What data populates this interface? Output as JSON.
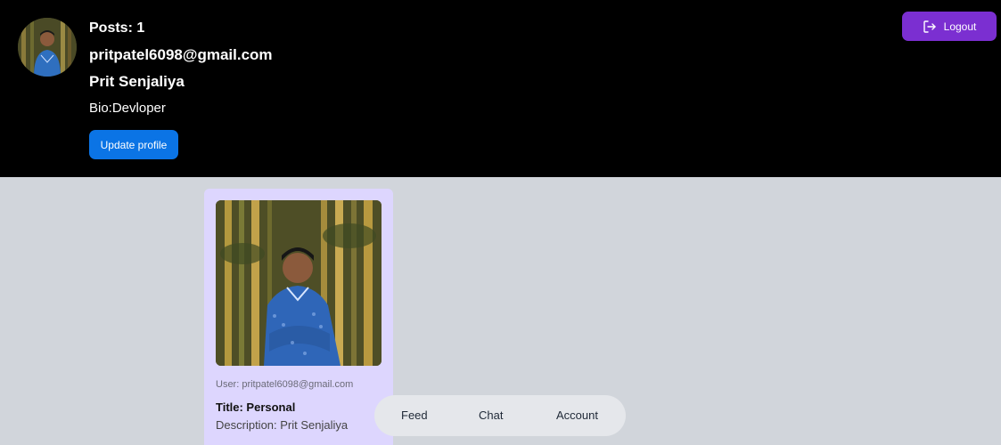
{
  "profile": {
    "posts_text": "Posts: 1",
    "email": "pritpatel6098@gmail.com",
    "name": "Prit Senjaliya",
    "bio_text": "Bio:Devloper",
    "avatar_icon": "user-photo"
  },
  "actions": {
    "update_profile_label": "Update profile",
    "logout_label": "Logout",
    "logout_icon": "logout-icon"
  },
  "posts": [
    {
      "user_text": "User: pritpatel6098@gmail.com",
      "title_text": "Title: Personal",
      "description_text": "Description: Prit Senjaliya"
    }
  ],
  "nav": {
    "items": [
      {
        "label": "Feed"
      },
      {
        "label": "Chat"
      },
      {
        "label": "Account"
      }
    ]
  },
  "colors": {
    "header_bg": "#000000",
    "page_bg": "#d1d5db",
    "update_button": "#0b74e5",
    "logout_button": "#7b2fd1",
    "card_bg": "#ddd6fe",
    "nav_bg": "#e5e7eb"
  }
}
